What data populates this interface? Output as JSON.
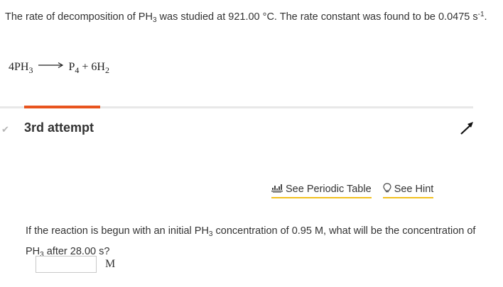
{
  "intro": {
    "text1": "The rate of decomposition of PH",
    "sub1": "3",
    "text2": " was studied at 921.00 °C. The rate constant was found to be 0.0475 s",
    "sup1": "-1",
    "text3": "."
  },
  "reaction": {
    "coef_reactant": "4PH",
    "sub_reactant": "3",
    "product1": "P",
    "sub_product1": "4",
    "plus": " + ",
    "product2": "6H",
    "sub_product2": "2"
  },
  "progress": {
    "fraction": 0.16,
    "color": "#e8541e"
  },
  "attempt": {
    "check_symbol": "✔",
    "label": "3rd attempt"
  },
  "tools": {
    "periodic_table_label": "See Periodic Table",
    "hint_label": "See Hint",
    "icons": [
      "periodic-table-icon",
      "lightbulb-icon"
    ]
  },
  "question": {
    "text1": "If the reaction is begun with an initial PH",
    "sub1": "3",
    "text2": " concentration of 0.95 M, what will be the concentration of PH",
    "sub2": "3",
    "text3": " after 28.00 s?"
  },
  "answer": {
    "value": "",
    "placeholder": "",
    "unit": "M"
  },
  "colors": {
    "accent": "#e8541e",
    "link_underline": "#f2c01e",
    "text": "#333333"
  }
}
